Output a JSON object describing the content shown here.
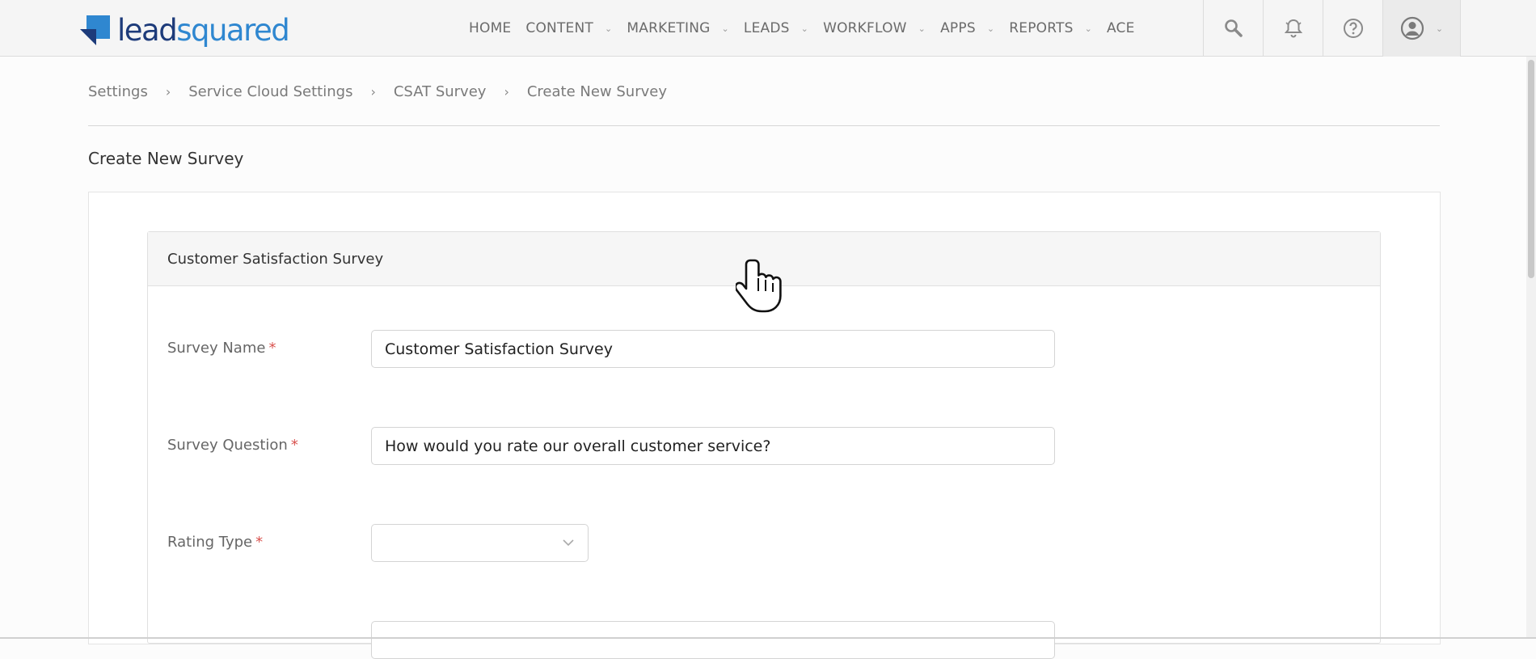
{
  "brand": {
    "logo_lead": "lead",
    "logo_squared": "squared",
    "logo_icon": "leadsquared-logo-icon"
  },
  "nav": {
    "items": [
      {
        "label": "HOME",
        "dropdown": false
      },
      {
        "label": "CONTENT",
        "dropdown": true
      },
      {
        "label": "MARKETING",
        "dropdown": true
      },
      {
        "label": "LEADS",
        "dropdown": true
      },
      {
        "label": "WORKFLOW",
        "dropdown": true
      },
      {
        "label": "APPS",
        "dropdown": true
      },
      {
        "label": "REPORTS",
        "dropdown": true
      },
      {
        "label": "ACE",
        "dropdown": false
      }
    ],
    "icons": [
      "search-icon",
      "bell-icon",
      "help-icon",
      "user-icon"
    ]
  },
  "breadcrumb": [
    "Settings",
    "Service Cloud Settings",
    "CSAT Survey",
    "Create New Survey"
  ],
  "page": {
    "title": "Create New Survey"
  },
  "panel": {
    "title": "Customer Satisfaction Survey",
    "fields": {
      "survey_name": {
        "label": "Survey Name",
        "required_mark": "*",
        "value": "Customer Satisfaction Survey"
      },
      "survey_question": {
        "label": "Survey Question",
        "required_mark": "*",
        "value": "How would you rate our overall customer service?"
      },
      "rating_type": {
        "label": "Rating Type",
        "required_mark": "*",
        "value": ""
      }
    }
  },
  "colors": {
    "brand_dark": "#1d3b7a",
    "brand_light": "#2f87d0",
    "required": "#d9534f"
  }
}
